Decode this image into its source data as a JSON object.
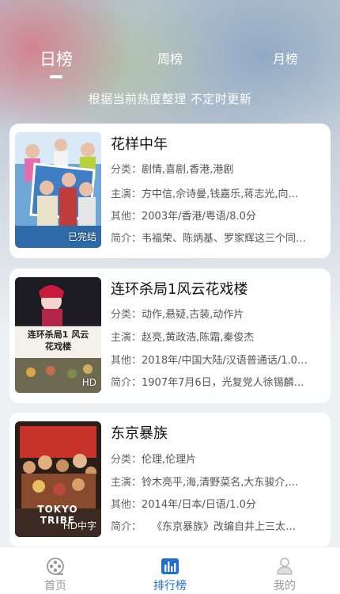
{
  "tabs": [
    {
      "label": "日榜",
      "active": true
    },
    {
      "label": "周榜",
      "active": false
    },
    {
      "label": "月榜",
      "active": false
    }
  ],
  "subtitle": "根据当前热度整理 不定时更新",
  "items": [
    {
      "title": "花样中年",
      "badge": "已完结",
      "genre_key": "分类：",
      "genre": "剧情,喜剧,香港,港剧",
      "cast_key": "主演：",
      "cast": "方中信,佘诗曼,钱嘉乐,蒋志光,向…",
      "other_key": "其他：",
      "other": "2003年/香港/粤语/8.0分",
      "intro_key": "简介：",
      "intro": "韦福荣、陈炳基、罗家辉这三个同…"
    },
    {
      "title": "连环杀局1风云花戏楼",
      "badge": "HD",
      "poster_text": "连环杀局1 风云花戏楼",
      "genre_key": "分类：",
      "genre": "动作,悬疑,古装,动作片",
      "cast_key": "主演：",
      "cast": "赵亮,黄政浩,陈霜,秦俊杰",
      "other_key": "其他：",
      "other": "2018年/中国大陆/汉语普通话/1.0…",
      "intro_key": "简介：",
      "intro": "1907年7月6日，光复党人徐锡麟…"
    },
    {
      "title": "东京暴族",
      "badge": "HD中字",
      "poster_text": "TOKYO TRIBE",
      "genre_key": "分类：",
      "genre": "伦理,伦理片",
      "cast_key": "主演：",
      "cast": "铃木亮平,海,清野菜名,大东骏介,…",
      "other_key": "其他：",
      "other": "2014年/日本/日语/1.0分",
      "intro_key": "简介：",
      "intro": "　　《东京暴族》改编自井上三太…"
    }
  ],
  "bottom_nav": [
    {
      "label": "首页",
      "icon": "film-reel-icon",
      "active": false
    },
    {
      "label": "排行榜",
      "icon": "bar-chart-icon",
      "active": true
    },
    {
      "label": "我的",
      "icon": "user-icon",
      "active": false
    }
  ],
  "colors": {
    "accent": "#1c6fd6",
    "inactive": "#999999"
  }
}
